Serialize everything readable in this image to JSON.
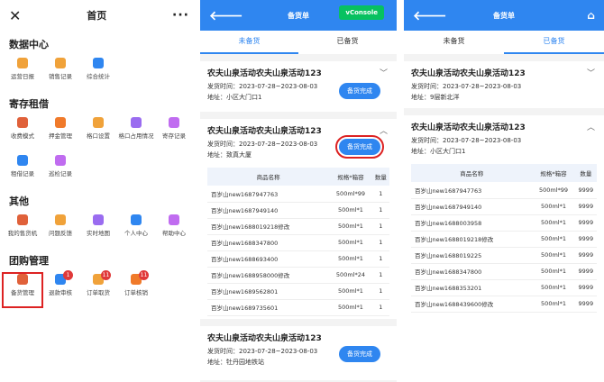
{
  "p1": {
    "title": "首页",
    "sections": [
      {
        "title": "数据中心",
        "items": [
          {
            "label": "运营日报",
            "icon": "report-icon",
            "color": "#f0a23a"
          },
          {
            "label": "销售记录",
            "icon": "sales-icon",
            "color": "#f0a23a"
          },
          {
            "label": "综合统计",
            "icon": "pie-icon",
            "color": "#2f86f0"
          }
        ]
      },
      {
        "title": "寄存租借",
        "items": [
          {
            "label": "收费模式",
            "icon": "fee-icon",
            "color": "#e0613a"
          },
          {
            "label": "押金管理",
            "icon": "deposit-icon",
            "color": "#f07a2a"
          },
          {
            "label": "格口设置",
            "icon": "slot-icon",
            "color": "#f0a23a"
          },
          {
            "label": "格口占用情况",
            "icon": "occupancy-icon",
            "color": "#9a6cf0"
          },
          {
            "label": "寄存记录",
            "icon": "storage-icon",
            "color": "#c06cf0"
          },
          {
            "label": "租借记录",
            "icon": "rent-icon",
            "color": "#2f86f0"
          },
          {
            "label": "巡检记录",
            "icon": "inspect-icon",
            "color": "#c06cf0"
          }
        ]
      },
      {
        "title": "其他",
        "items": [
          {
            "label": "我的售货机",
            "icon": "machine-icon",
            "color": "#e0613a"
          },
          {
            "label": "问题反馈",
            "icon": "feedback-icon",
            "color": "#f0a23a"
          },
          {
            "label": "实时地图",
            "icon": "map-icon",
            "color": "#9a6cf0"
          },
          {
            "label": "个人中心",
            "icon": "user-icon",
            "color": "#2f86f0"
          },
          {
            "label": "帮助中心",
            "icon": "help-icon",
            "color": "#c06cf0"
          }
        ]
      },
      {
        "title": "团购管理",
        "items": [
          {
            "label": "备货管理",
            "icon": "stock-icon",
            "color": "#e0613a",
            "hl": true
          },
          {
            "label": "退款审核",
            "icon": "refund-icon",
            "color": "#2f86f0",
            "badge": "1"
          },
          {
            "label": "订单取货",
            "icon": "pickup-icon",
            "color": "#f0a23a",
            "badge": "11"
          },
          {
            "label": "订单核销",
            "icon": "verify-icon",
            "color": "#f07a2a",
            "badge": "11"
          }
        ]
      }
    ]
  },
  "p2": {
    "title": "备货单",
    "vconsole": "vConsole",
    "tab1": "未备货",
    "tab2": "已备货",
    "btn": "备货完成",
    "c1": {
      "title": "农夫山泉活动农夫山泉活动123",
      "time": "发货时间：2023-07-28~2023-08-03",
      "addr": "地址：小区大门口1"
    },
    "c2": {
      "title": "农夫山泉活动农夫山泉活动123",
      "time": "发货时间：2023-07-28~2023-08-03",
      "addr": "地址：致真大厦"
    },
    "c3": {
      "title": "农夫山泉活动农夫山泉活动123",
      "time": "发货时间：2023-07-28~2023-08-03",
      "addr": "地址：牡丹园地铁站"
    },
    "th": [
      "商品名称",
      "规格*箱容",
      "数量"
    ],
    "rows": [
      [
        "百岁山new1687947763",
        "500ml*99",
        "1"
      ],
      [
        "百岁山new1687949140",
        "500ml*1",
        "1"
      ],
      [
        "百岁山new1688019218修改",
        "500ml*1",
        "1"
      ],
      [
        "百岁山new1688347800",
        "500ml*1",
        "1"
      ],
      [
        "百岁山new1688693400",
        "500ml*1",
        "1"
      ],
      [
        "百岁山new1688958000修改",
        "500ml*24",
        "1"
      ],
      [
        "百岁山new1689562801",
        "500ml*1",
        "1"
      ],
      [
        "百岁山new1689735601",
        "500ml*1",
        "1"
      ]
    ]
  },
  "p3": {
    "title": "备货单",
    "tab1": "未备货",
    "tab2": "已备货",
    "c1": {
      "title": "农夫山泉活动农夫山泉活动123",
      "time": "发货时间：2023-07-28~2023-08-03",
      "addr": "地址：9层新北洋"
    },
    "c2": {
      "title": "农夫山泉活动农夫山泉活动123",
      "time": "发货时间：2023-07-28~2023-08-03",
      "addr": "地址：小区大门口1"
    },
    "th": [
      "商品名称",
      "规格*箱容",
      "数量"
    ],
    "rows": [
      [
        "百岁山new1687947763",
        "500ml*99",
        "9999"
      ],
      [
        "百岁山new1687949140",
        "500ml*1",
        "9999"
      ],
      [
        "百岁山new1688003958",
        "500ml*1",
        "9999"
      ],
      [
        "百岁山new1688019218修改",
        "500ml*1",
        "9999"
      ],
      [
        "百岁山new1688019225",
        "500ml*1",
        "9999"
      ],
      [
        "百岁山new1688347800",
        "500ml*1",
        "9999"
      ],
      [
        "百岁山new1688353201",
        "500ml*1",
        "9999"
      ],
      [
        "百岁山new1688439600修改",
        "500ml*1",
        "9999"
      ]
    ]
  }
}
